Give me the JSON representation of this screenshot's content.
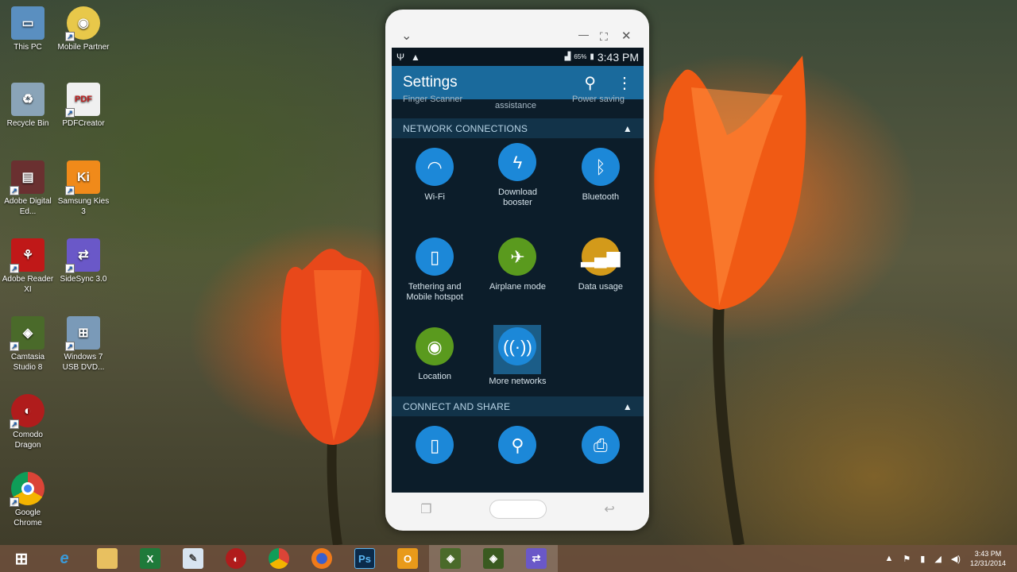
{
  "desktop": {
    "icons": [
      {
        "label": "This PC",
        "icon": "computer-icon"
      },
      {
        "label": "Mobile Partner",
        "icon": "mobile-partner-icon"
      },
      {
        "label": "Recycle Bin",
        "icon": "recycle-bin-icon"
      },
      {
        "label": "PDFCreator",
        "icon": "pdfcreator-icon"
      },
      {
        "label": "Adobe Digital Ed...",
        "icon": "adobe-digital-editions-icon"
      },
      {
        "label": "Samsung Kies 3",
        "icon": "samsung-kies-icon"
      },
      {
        "label": "Adobe Reader XI",
        "icon": "adobe-reader-icon"
      },
      {
        "label": "SideSync 3.0",
        "icon": "sidesync-icon"
      },
      {
        "label": "Camtasia Studio 8",
        "icon": "camtasia-icon"
      },
      {
        "label": "Windows 7 USB DVD...",
        "icon": "windows7-usb-dvd-icon"
      },
      {
        "label": "Comodo Dragon",
        "icon": "comodo-dragon-icon"
      },
      {
        "label": "Google Chrome",
        "icon": "chrome-icon"
      }
    ]
  },
  "phone": {
    "window_controls": {
      "collapse": "⌄",
      "minimize": "—",
      "maximize": "⛶",
      "close": "✕"
    },
    "status": {
      "battery_pct": "65%",
      "time": "3:43 PM"
    },
    "appbar": {
      "title": "Settings"
    },
    "prev_row": [
      "Finger Scanner",
      "assistance",
      "Power saving"
    ],
    "sections": [
      {
        "title": "NETWORK CONNECTIONS",
        "tiles": [
          {
            "label": "Wi-Fi",
            "icon": "wifi-icon",
            "color": "#1c88d8"
          },
          {
            "label": "Download booster",
            "icon": "download-booster-icon",
            "color": "#1c88d8"
          },
          {
            "label": "Bluetooth",
            "icon": "bluetooth-icon",
            "color": "#1c88d8"
          },
          {
            "label": "Tethering and Mobile hotspot",
            "icon": "tethering-icon",
            "color": "#1c88d8"
          },
          {
            "label": "Airplane mode",
            "icon": "airplane-icon",
            "color": "#5a9a1e"
          },
          {
            "label": "Data usage",
            "icon": "data-usage-icon",
            "color": "#d39a1a"
          },
          {
            "label": "Location",
            "icon": "location-icon",
            "color": "#5a9a1e"
          },
          {
            "label": "More networks",
            "icon": "more-networks-icon",
            "color": "#1c88d8",
            "selected": true
          }
        ]
      },
      {
        "title": "CONNECT AND SHARE",
        "tiles": [
          {
            "label": "",
            "icon": "nfc-icon",
            "color": "#1c88d8"
          },
          {
            "label": "",
            "icon": "nearby-devices-icon",
            "color": "#1c88d8"
          },
          {
            "label": "",
            "icon": "printing-icon",
            "color": "#1c88d8"
          }
        ]
      }
    ]
  },
  "taskbar": {
    "items": [
      {
        "icon": "windows-start-icon"
      },
      {
        "icon": "internet-explorer-icon"
      },
      {
        "icon": "file-explorer-icon"
      },
      {
        "icon": "excel-icon"
      },
      {
        "icon": "paint-icon"
      },
      {
        "icon": "comodo-dragon-icon"
      },
      {
        "icon": "chrome-icon"
      },
      {
        "icon": "firefox-icon"
      },
      {
        "icon": "photoshop-icon"
      },
      {
        "icon": "outlook-icon"
      },
      {
        "icon": "camtasia-recorder-icon"
      },
      {
        "icon": "camtasia-studio-icon"
      },
      {
        "icon": "sidesync-icon"
      }
    ],
    "clock": {
      "time": "3:43 PM",
      "date": "12/31/2014"
    }
  }
}
